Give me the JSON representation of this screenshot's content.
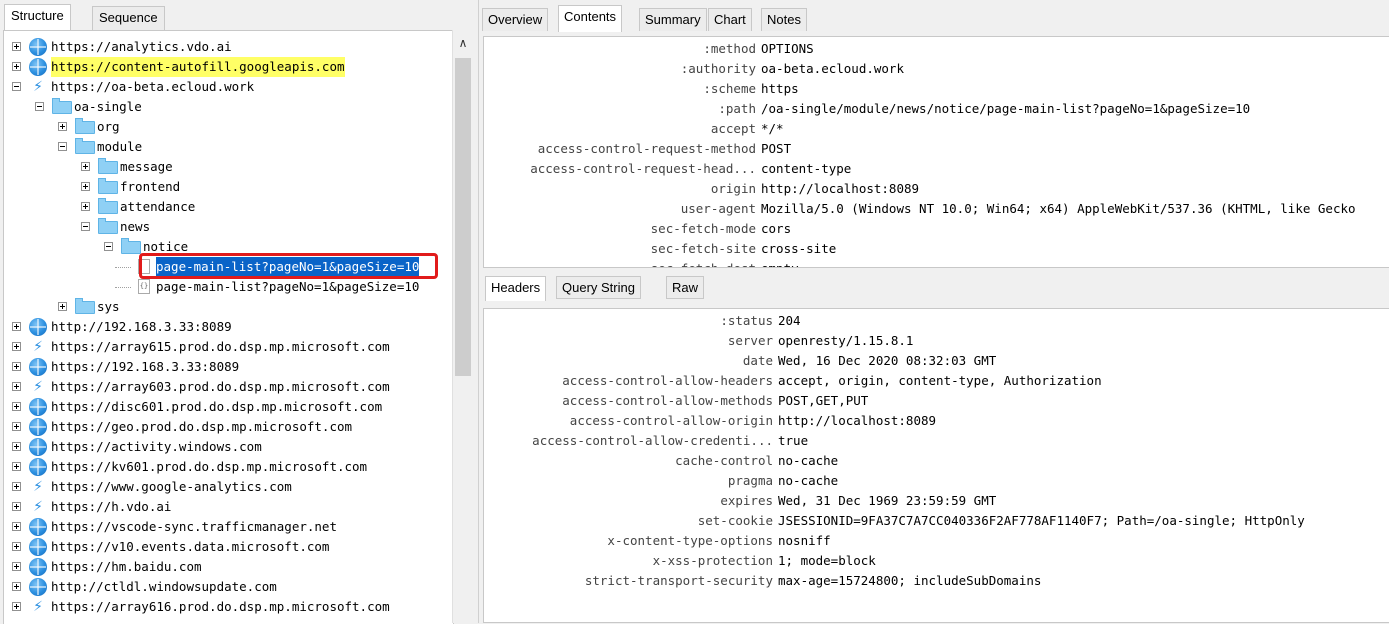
{
  "left_tabs": [
    "Structure",
    "Sequence"
  ],
  "tree": [
    {
      "indent": 0,
      "exp": "plus",
      "icon": "globe",
      "label": "https://analytics.vdo.ai"
    },
    {
      "indent": 0,
      "exp": "plus",
      "icon": "globe",
      "label": "https://content-autofill.googleapis.com",
      "highlight": "yellow"
    },
    {
      "indent": 0,
      "exp": "minus",
      "icon": "bolt",
      "label": "https://oa-beta.ecloud.work"
    },
    {
      "indent": 1,
      "exp": "minus",
      "icon": "folder",
      "label": "oa-single"
    },
    {
      "indent": 2,
      "exp": "plus",
      "icon": "folder",
      "label": "org"
    },
    {
      "indent": 2,
      "exp": "minus",
      "icon": "folder",
      "label": "module"
    },
    {
      "indent": 3,
      "exp": "plus",
      "icon": "folder",
      "label": "message"
    },
    {
      "indent": 3,
      "exp": "plus",
      "icon": "folder",
      "label": "frontend"
    },
    {
      "indent": 3,
      "exp": "plus",
      "icon": "folder",
      "label": "attendance"
    },
    {
      "indent": 3,
      "exp": "minus",
      "icon": "folder",
      "label": "news"
    },
    {
      "indent": 4,
      "exp": "minus",
      "icon": "folder",
      "label": "notice"
    },
    {
      "indent": 5,
      "exp": "none",
      "icon": "doc",
      "label": "page-main-list?pageNo=1&pageSize=10",
      "highlight": "selected"
    },
    {
      "indent": 5,
      "exp": "none",
      "icon": "json",
      "label": "page-main-list?pageNo=1&pageSize=10"
    },
    {
      "indent": 2,
      "exp": "plus",
      "icon": "folder",
      "label": "sys"
    },
    {
      "indent": 0,
      "exp": "plus",
      "icon": "globe",
      "label": "http://192.168.3.33:8089"
    },
    {
      "indent": 0,
      "exp": "plus",
      "icon": "bolt",
      "label": "https://array615.prod.do.dsp.mp.microsoft.com"
    },
    {
      "indent": 0,
      "exp": "plus",
      "icon": "globe",
      "label": "https://192.168.3.33:8089"
    },
    {
      "indent": 0,
      "exp": "plus",
      "icon": "bolt",
      "label": "https://array603.prod.do.dsp.mp.microsoft.com"
    },
    {
      "indent": 0,
      "exp": "plus",
      "icon": "globe",
      "label": "https://disc601.prod.do.dsp.mp.microsoft.com"
    },
    {
      "indent": 0,
      "exp": "plus",
      "icon": "globe",
      "label": "https://geo.prod.do.dsp.mp.microsoft.com"
    },
    {
      "indent": 0,
      "exp": "plus",
      "icon": "globe",
      "label": "https://activity.windows.com"
    },
    {
      "indent": 0,
      "exp": "plus",
      "icon": "globe",
      "label": "https://kv601.prod.do.dsp.mp.microsoft.com"
    },
    {
      "indent": 0,
      "exp": "plus",
      "icon": "bolt",
      "label": "https://www.google-analytics.com"
    },
    {
      "indent": 0,
      "exp": "plus",
      "icon": "bolt",
      "label": "https://h.vdo.ai"
    },
    {
      "indent": 0,
      "exp": "plus",
      "icon": "globe",
      "label": "https://vscode-sync.trafficmanager.net"
    },
    {
      "indent": 0,
      "exp": "plus",
      "icon": "globe",
      "label": "https://v10.events.data.microsoft.com"
    },
    {
      "indent": 0,
      "exp": "plus",
      "icon": "globe",
      "label": "https://hm.baidu.com"
    },
    {
      "indent": 0,
      "exp": "plus",
      "icon": "globe",
      "label": "http://ctldl.windowsupdate.com"
    },
    {
      "indent": 0,
      "exp": "plus",
      "icon": "bolt",
      "label": "https://array616.prod.do.dsp.mp.microsoft.com"
    }
  ],
  "right_tabs": [
    "Overview",
    "Contents",
    "Summary",
    "Chart",
    "Notes"
  ],
  "request_headers": [
    {
      "k": ":method",
      "v": "OPTIONS"
    },
    {
      "k": ":authority",
      "v": "oa-beta.ecloud.work"
    },
    {
      "k": ":scheme",
      "v": "https"
    },
    {
      "k": ":path",
      "v": "/oa-single/module/news/notice/page-main-list?pageNo=1&pageSize=10"
    },
    {
      "k": "accept",
      "v": "*/*"
    },
    {
      "k": "access-control-request-method",
      "v": "POST"
    },
    {
      "k": "access-control-request-head...",
      "v": "content-type"
    },
    {
      "k": "origin",
      "v": "http://localhost:8089"
    },
    {
      "k": "user-agent",
      "v": "Mozilla/5.0 (Windows NT 10.0; Win64; x64) AppleWebKit/537.36 (KHTML, like Gecko"
    },
    {
      "k": "sec-fetch-mode",
      "v": "cors"
    },
    {
      "k": "sec-fetch-site",
      "v": "cross-site"
    },
    {
      "k": "sec-fetch-dest",
      "v": "empty"
    }
  ],
  "sub_tabs": [
    "Headers",
    "Query String",
    "Raw"
  ],
  "response_headers": [
    {
      "k": ":status",
      "v": "204"
    },
    {
      "k": "server",
      "v": "openresty/1.15.8.1"
    },
    {
      "k": "date",
      "v": "Wed, 16 Dec 2020 08:32:03 GMT"
    },
    {
      "k": "access-control-allow-headers",
      "v": "accept, origin, content-type, Authorization"
    },
    {
      "k": "access-control-allow-methods",
      "v": "POST,GET,PUT"
    },
    {
      "k": "access-control-allow-origin",
      "v": "http://localhost:8089"
    },
    {
      "k": "access-control-allow-credenti...",
      "v": "true"
    },
    {
      "k": "cache-control",
      "v": "no-cache"
    },
    {
      "k": "pragma",
      "v": "no-cache"
    },
    {
      "k": "expires",
      "v": "Wed, 31 Dec 1969 23:59:59 GMT"
    },
    {
      "k": "set-cookie",
      "v": "JSESSIONID=9FA37C7A7CC040336F2AF778AF1140F7; Path=/oa-single; HttpOnly"
    },
    {
      "k": "x-content-type-options",
      "v": "nosniff"
    },
    {
      "k": "x-xss-protection",
      "v": "1; mode=block"
    },
    {
      "k": "strict-transport-security",
      "v": "max-age=15724800; includeSubDomains"
    }
  ],
  "scroll_up_arrow": "∧",
  "colors": {
    "selection": "#0a64c8",
    "yellow_highlight": "#ffff66",
    "annotation_red": "#e11b1b"
  }
}
